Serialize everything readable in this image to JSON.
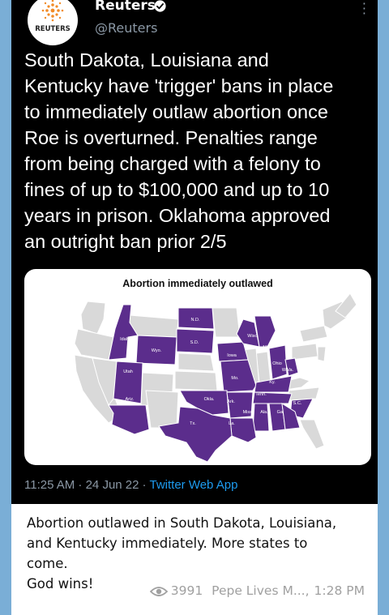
{
  "tweet": {
    "account_name": "Reuters",
    "handle": "@Reuters",
    "avatar_text": "REUTERS",
    "lines": [
      "South Dakota, Louisiana and",
      "Kentucky have 'trigger' bans in place",
      "to immediately outlaw abortion once",
      "Roe is overturned. Penalties range",
      "from being charged with a felony to",
      "fines of up to $100,000 and up to 10",
      "years in prison. Oklahoma approved",
      "an outright ban prior 2/5"
    ],
    "timestamp": "11:25 AM · 24 Jun 22",
    "separator": "·",
    "source_app": "Twitter Web App"
  },
  "map": {
    "title": "Abortion immediately outlawed",
    "outlawed_color": "#5b2d8c",
    "other_color": "#d9d9d9",
    "labels": [
      "N.D.",
      "Idaho",
      "S.D.",
      "Wyo.",
      "Wisc.",
      "Mi.",
      "Iowa",
      "Ohio",
      "Utah",
      "Mo.",
      "W.Va.",
      "Ky.",
      "Ariz.",
      "Okla.",
      "Ark.",
      "Tenn.",
      "S.C.",
      "Miss.",
      "Ala.",
      "Ga.",
      "La.",
      "Tx."
    ]
  },
  "caption": {
    "lines": [
      "Abortion outlawed in South Dakota, Louisiana,",
      "and Kentucky immediately. More states to",
      "come.",
      "God wins!"
    ]
  },
  "footer": {
    "views": "3991",
    "author": "Pepe Lives M...,",
    "time": "1:28 PM"
  }
}
